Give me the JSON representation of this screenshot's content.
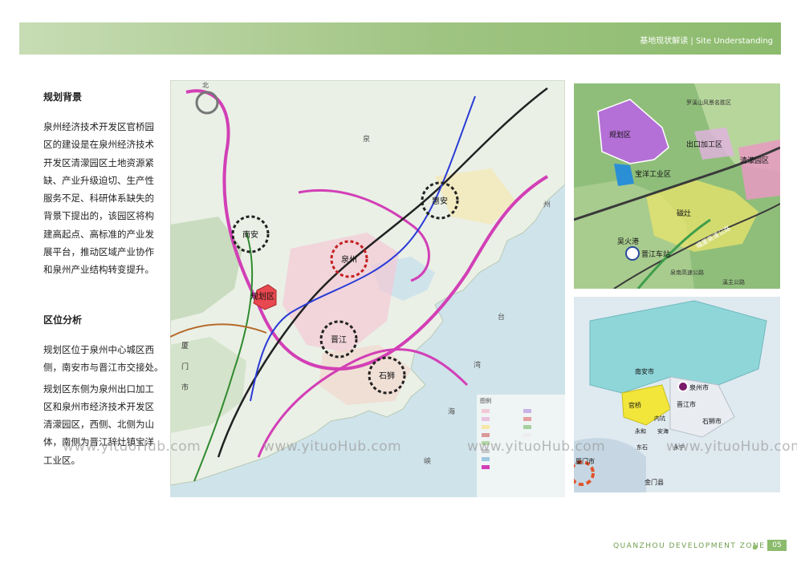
{
  "header": {
    "title": "基地现状解读 | Site Understanding"
  },
  "sections": {
    "background": {
      "title": "规划背景",
      "lines": [
        "泉州经济技术开发区官桥园",
        "区的建设是在泉州经济技术",
        "开发区清濛园区土地资源紧",
        "缺、产业升级迫切、生产性",
        "服务不足、科研体系缺失的",
        "背景下提出的，该园区将构",
        "建高起点、高标准的产业发",
        "展平台，推动区域产业协作",
        "和泉州产业结构转变提升。"
      ]
    },
    "location": {
      "title": "区位分析",
      "p1_lines": [
        "规划区位于泉州中心城区西",
        "侧，南安市与晋江市交接处。"
      ],
      "p2_lines": [
        "规划区东侧为泉州出口加工",
        "区和泉州市经济技术开发区",
        "清濛园区，西侧、北侧为山",
        "体，南侧为晋江辞灶镇宝洋",
        "工业区。"
      ]
    }
  },
  "main_map": {
    "north_label": "北",
    "cities": [
      "南安",
      "惠安",
      "泉州",
      "晋江",
      "石狮"
    ],
    "plan_area": "规划区",
    "side_label_left": [
      "厦",
      "门",
      "市"
    ],
    "sea_labels": [
      "泉",
      "州",
      "湾",
      "台",
      "湾",
      "海",
      "峡"
    ],
    "legend_title": "图例"
  },
  "inset1": {
    "labels": [
      "规划区",
      "出口加工区",
      "清濛园区",
      "宝洋工业区",
      "磁灶",
      "吴火港",
      "晋江车站",
      "福厦高速公路",
      "罗溪山风景名胜区",
      "泉南高速公路",
      "溪主公路"
    ]
  },
  "inset2": {
    "labels": [
      "南安市",
      "泉州市",
      "官桥",
      "晋江市",
      "内坑",
      "石狮市",
      "永和",
      "安海",
      "东石",
      "永宁",
      "厦门市",
      "金门县"
    ]
  },
  "watermarks": [
    "www.yituoHub.com",
    "www.yituoHub.com",
    "www.yituoHub.com",
    "www.yituoHub.com"
  ],
  "footer": {
    "text": "QUANZHOU DEVELOPMENT ZONE",
    "page": "05"
  },
  "colors": {
    "header": "#9fc482",
    "accent": "#8cbb6d",
    "sea": "#cfe3ea",
    "land": "#e9efe4",
    "plan_area": "#e8484f",
    "boundary_magenta": "#d23fb6"
  }
}
